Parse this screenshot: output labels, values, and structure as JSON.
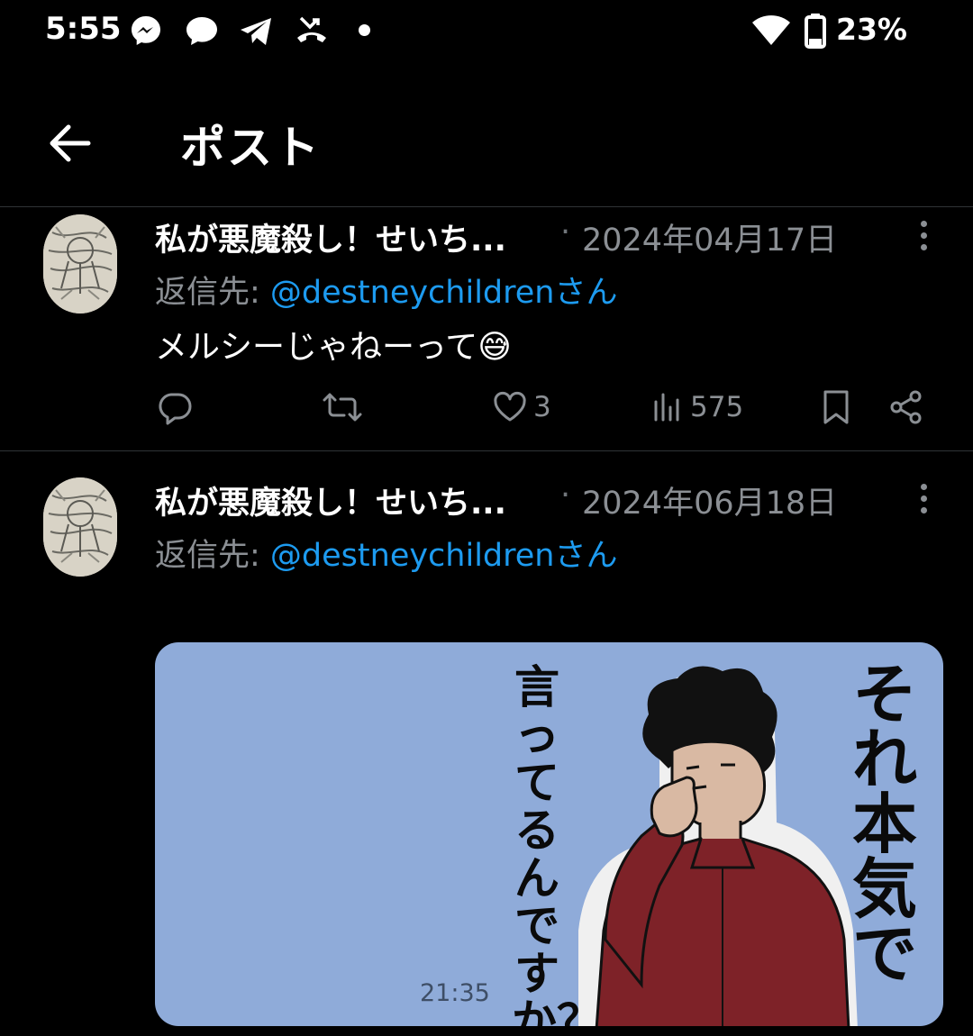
{
  "status_bar": {
    "time": "5:55",
    "battery": "23%",
    "icons": [
      "messenger-icon",
      "chat-bubble-icon",
      "telegram-icon",
      "missed-call-icon",
      "notification-dot-icon",
      "wifi-icon",
      "battery-icon"
    ]
  },
  "header": {
    "title": "ポスト",
    "back_icon": "arrow-left-icon"
  },
  "posts": [
    {
      "author": "私が悪魔殺し！せいち...",
      "separator": "·",
      "date": "2024年04月17日",
      "reply_prefix": "返信先: ",
      "reply_handle": "@destneychildren",
      "reply_suffix": "さん",
      "text": "メルシーじゃねーって😅",
      "actions": {
        "reply_count": "",
        "repost_count": "",
        "like_count": "3",
        "view_count": "575"
      }
    },
    {
      "author": "私が悪魔殺し！せいち...",
      "separator": "·",
      "date": "2024年06月18日",
      "reply_prefix": "返信先: ",
      "reply_handle": "@destneychildren",
      "reply_suffix": "さん",
      "sticker": {
        "text_main": "それ本気で",
        "text_sub": "言ってるんですか？",
        "timestamp": "21:35",
        "background": "#8fabd9",
        "shirt_color": "#7e2228"
      }
    }
  ],
  "colors": {
    "background": "#000000",
    "link": "#1d9bf0",
    "muted": "#8b8f94",
    "divider": "#2f3336"
  }
}
